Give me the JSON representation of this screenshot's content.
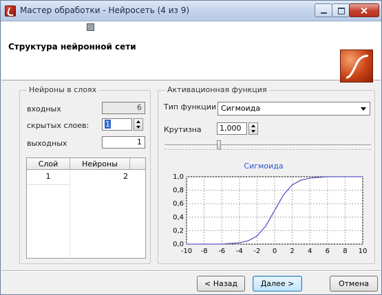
{
  "window": {
    "title": "Мастер обработки - Нейросеть (4 из 9)"
  },
  "header": {
    "title": "Структура нейронной сети"
  },
  "neurons_group": {
    "title": "Нейроны в слоях",
    "input_label": "входных",
    "input_value": "6",
    "hidden_label": "скрытых слоев:",
    "hidden_value": "1",
    "output_label": "выходных",
    "output_value": "1",
    "table": {
      "columns": [
        "Слой",
        "Нейроны"
      ],
      "rows": [
        {
          "layer": "1",
          "neurons": "2"
        }
      ]
    }
  },
  "activation_group": {
    "title": "Активационная функция",
    "type_label": "Тип функции",
    "type_value": "Сигмоида",
    "slope_label": "Крутизна",
    "slope_value": "1,000",
    "slope_level_fraction": 0.26,
    "plot_title": "Сигмоида",
    "plot_y_ticks": [
      "1,0",
      "0,8",
      "0,6",
      "0,4",
      "0,2",
      "0,0"
    ],
    "plot_x_ticks": [
      "-10",
      "-8",
      "-6",
      "-4",
      "-2",
      "0",
      "2",
      "4",
      "6",
      "8",
      "10"
    ],
    "curve_color": "#5a57c8"
  },
  "chart_data": {
    "type": "line",
    "title": "Сигмоида",
    "xlim": [
      -10,
      10
    ],
    "ylim": [
      0,
      1
    ],
    "x_ticks": [
      -10,
      -8,
      -6,
      -4,
      -2,
      0,
      2,
      4,
      6,
      8,
      10
    ],
    "y_ticks": [
      0,
      0.2,
      0.4,
      0.6,
      0.8,
      1.0
    ],
    "grid": true,
    "series": [
      {
        "x": [
          -10,
          -8,
          -6,
          -4,
          -3,
          -2,
          -1,
          0,
          1,
          2,
          3,
          4,
          6,
          8,
          10
        ],
        "y": [
          0.0,
          0.0,
          0.0,
          0.02,
          0.05,
          0.12,
          0.27,
          0.5,
          0.73,
          0.88,
          0.95,
          0.98,
          1.0,
          1.0,
          1.0
        ]
      }
    ]
  },
  "buttons": {
    "back": "< Назад",
    "next": "Далее >",
    "cancel": "Отмена"
  }
}
